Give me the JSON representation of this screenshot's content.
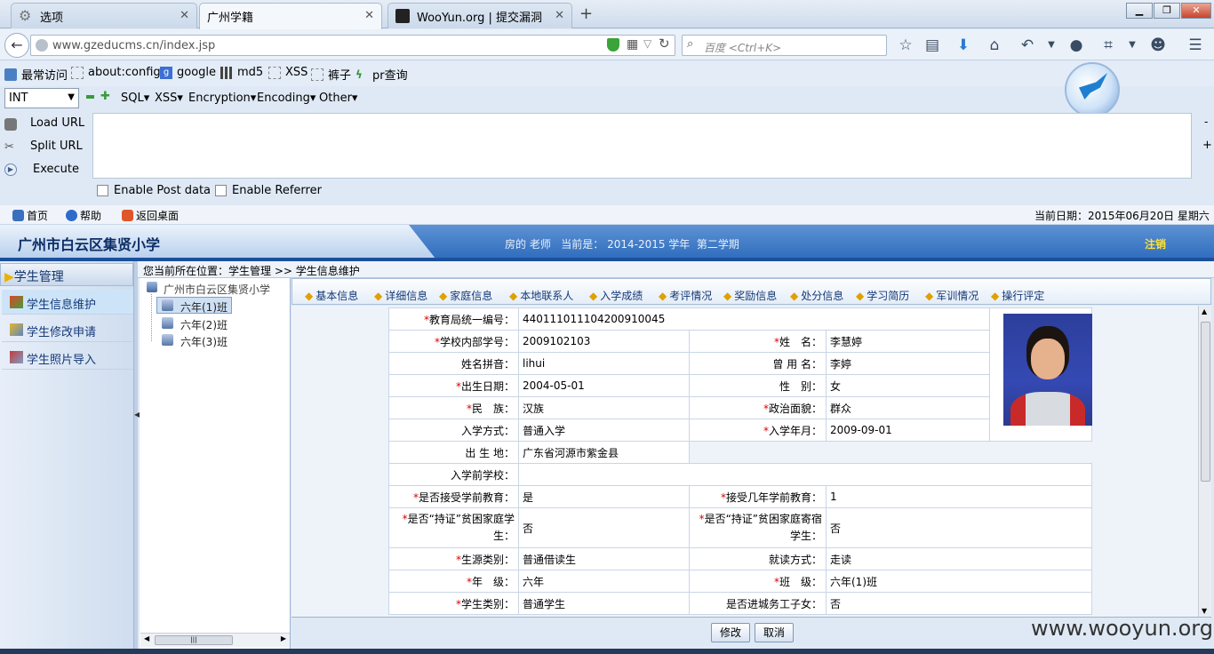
{
  "browser": {
    "tabs": [
      {
        "label": "选项"
      },
      {
        "label": "广州学籍"
      },
      {
        "label": "WooYun.org | 提交漏洞"
      }
    ],
    "new_tab": "+",
    "url": "www.gzeducms.cn/index.jsp",
    "search_placeholder": "百度 <Ctrl+K>",
    "bookmarks": [
      "最常访问",
      "about:config",
      "google",
      "md5",
      "XSS",
      "裤子",
      "pr查询"
    ]
  },
  "hackbar": {
    "select_value": "INT",
    "menus": [
      "SQL▾",
      "XSS▾",
      "Encryption▾",
      "Encoding▾",
      "Other▾"
    ],
    "load_url": "Load URL",
    "split_url": "Split URL",
    "execute": "Execute",
    "enable_post": "Enable Post data",
    "enable_referrer": "Enable Referrer"
  },
  "app": {
    "top_links": [
      "首页",
      "帮助",
      "返回桌面"
    ],
    "current_date": "当前日期：2015年06月20日 星期六",
    "school_title": "广州市白云区集贤小学",
    "teacher_info": "房的 老师   当前是： 2014-2015 学年  第二学期",
    "logout": "注销",
    "left_nav": {
      "header": "学生管理",
      "items": [
        "学生信息维护",
        "学生修改申请",
        "学生照片导入"
      ]
    },
    "breadcrumb": "您当前所在位置：学生管理 >> 学生信息维护",
    "tree": {
      "root": "广州市白云区集贤小学",
      "classes": [
        "六年(1)班",
        "六年(2)班",
        "六年(3)班"
      ]
    },
    "sub_tabs": [
      "基本信息",
      "详细信息",
      "家庭信息",
      "本地联系人",
      "入学成绩",
      "考评情况",
      "奖励信息",
      "处分信息",
      "学习简历",
      "军训情况",
      "操行评定"
    ],
    "form": {
      "edu_id_label": "教育局统一编号：",
      "edu_id": "440111011104200910045",
      "school_id_label": "学校内部学号：",
      "school_id": "2009102103",
      "name_label": "姓　名：",
      "name": "李慧婷",
      "pinyin_label": "姓名拼音：",
      "pinyin": "lihui",
      "former_name_label": "曾 用 名：",
      "former_name": "李婷",
      "birth_label": "出生日期：",
      "birth": "2004-05-01",
      "gender_label": "性　别：",
      "gender": "女",
      "ethnic_label": "民　族：",
      "ethnic": "汉族",
      "political_label": "政治面貌：",
      "political": "群众",
      "entry_mode_label": "入学方式：",
      "entry_mode": "普通入学",
      "entry_date_label": "入学年月：",
      "entry_date": "2009-09-01",
      "birthplace_label": "出 生 地：",
      "birthplace": "广东省河源市紫金县",
      "prev_school_label": "入学前学校：",
      "prev_school": "",
      "preschool_label": "是否接受学前教育：",
      "preschool": "是",
      "preschool_years_label": "接受几年学前教育：",
      "preschool_years": "1",
      "poor_label": "是否“持证”贫困家庭学生：",
      "poor": "否",
      "poor_board_label": "是否“持证”贫困家庭寄宿学生：",
      "poor_board": "否",
      "source_label": "生源类别：",
      "source": "普通借读生",
      "study_mode_label": "就读方式：",
      "study_mode": "走读",
      "grade_label": "年　级：",
      "grade": "六年",
      "class_label": "班　级：",
      "class": "六年(1)班",
      "category_label": "学生类别：",
      "category": "普通学生",
      "migrant_label": "是否进城务工子女：",
      "migrant": "否"
    },
    "buttons": {
      "edit": "修改",
      "cancel": "取消"
    }
  },
  "watermark": "www.wooyun.org"
}
